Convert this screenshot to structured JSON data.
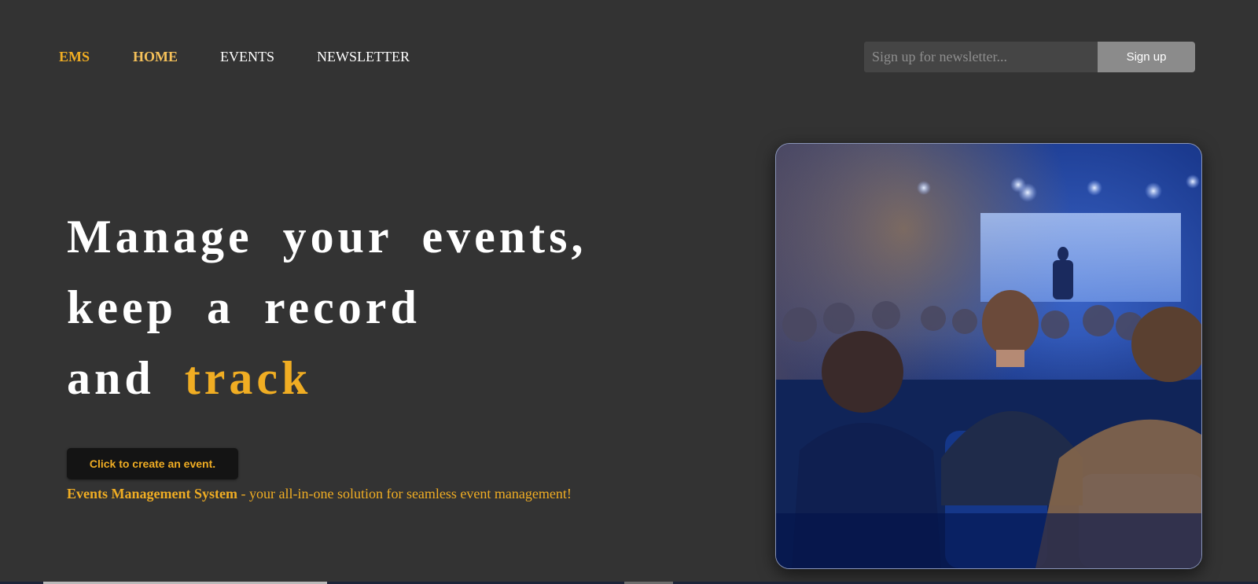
{
  "nav": {
    "brand": "EMS",
    "links": [
      "HOME",
      "EVENTS",
      "NEWSLETTER"
    ]
  },
  "newsletter": {
    "placeholder": "Sign up for newsletter...",
    "button_label": "Sign up"
  },
  "hero": {
    "line1": "Manage your events,",
    "line2": "keep a record",
    "line3_prefix": "and",
    "line3_accent": "track",
    "cta_label": "Click to create an event.",
    "tagline_bold": "Events Management System",
    "tagline_rest": " - your all-in-one solution for seamless event management!"
  },
  "image": {
    "subject": "conference-audience-photo"
  },
  "colors": {
    "background": "#333333",
    "accent": "#f0ad23",
    "home_link": "#f5c15a",
    "signup_input": "#454545",
    "signup_button": "#8b8b8b",
    "cta_bg": "#141414"
  }
}
